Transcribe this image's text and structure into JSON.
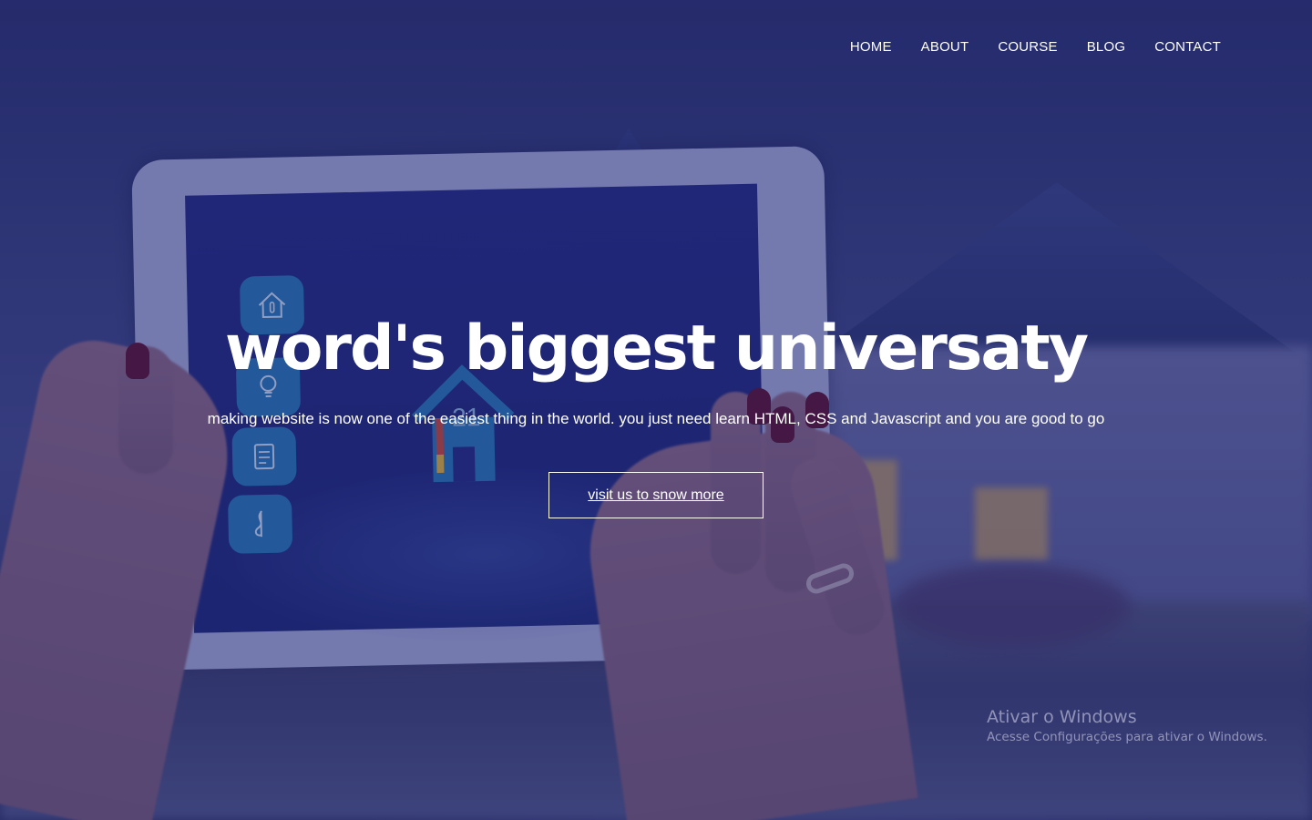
{
  "nav": {
    "items": [
      "HOME",
      "ABOUT",
      "COURSE",
      "BLOG",
      "CONTACT"
    ]
  },
  "hero": {
    "title": "word's biggest universaty",
    "subtitle": "making website is now one of the easiest thing in the world. you just need learn HTML, CSS and Javascript and you are good to go",
    "cta_label": "visit us to snow more",
    "screen_number": "21"
  },
  "os_watermark": {
    "title": "Ativar o Windows",
    "subtitle": "Acesse Configurações para ativar o Windows."
  },
  "colors": {
    "overlay": "#1c2268",
    "screen": "#262d83",
    "app_tile": "#2a78b8",
    "text": "#ffffff"
  },
  "icons": [
    "house-thermometer-icon",
    "lightbulb-icon",
    "checklist-icon",
    "music-note-icon",
    "house-icon"
  ]
}
